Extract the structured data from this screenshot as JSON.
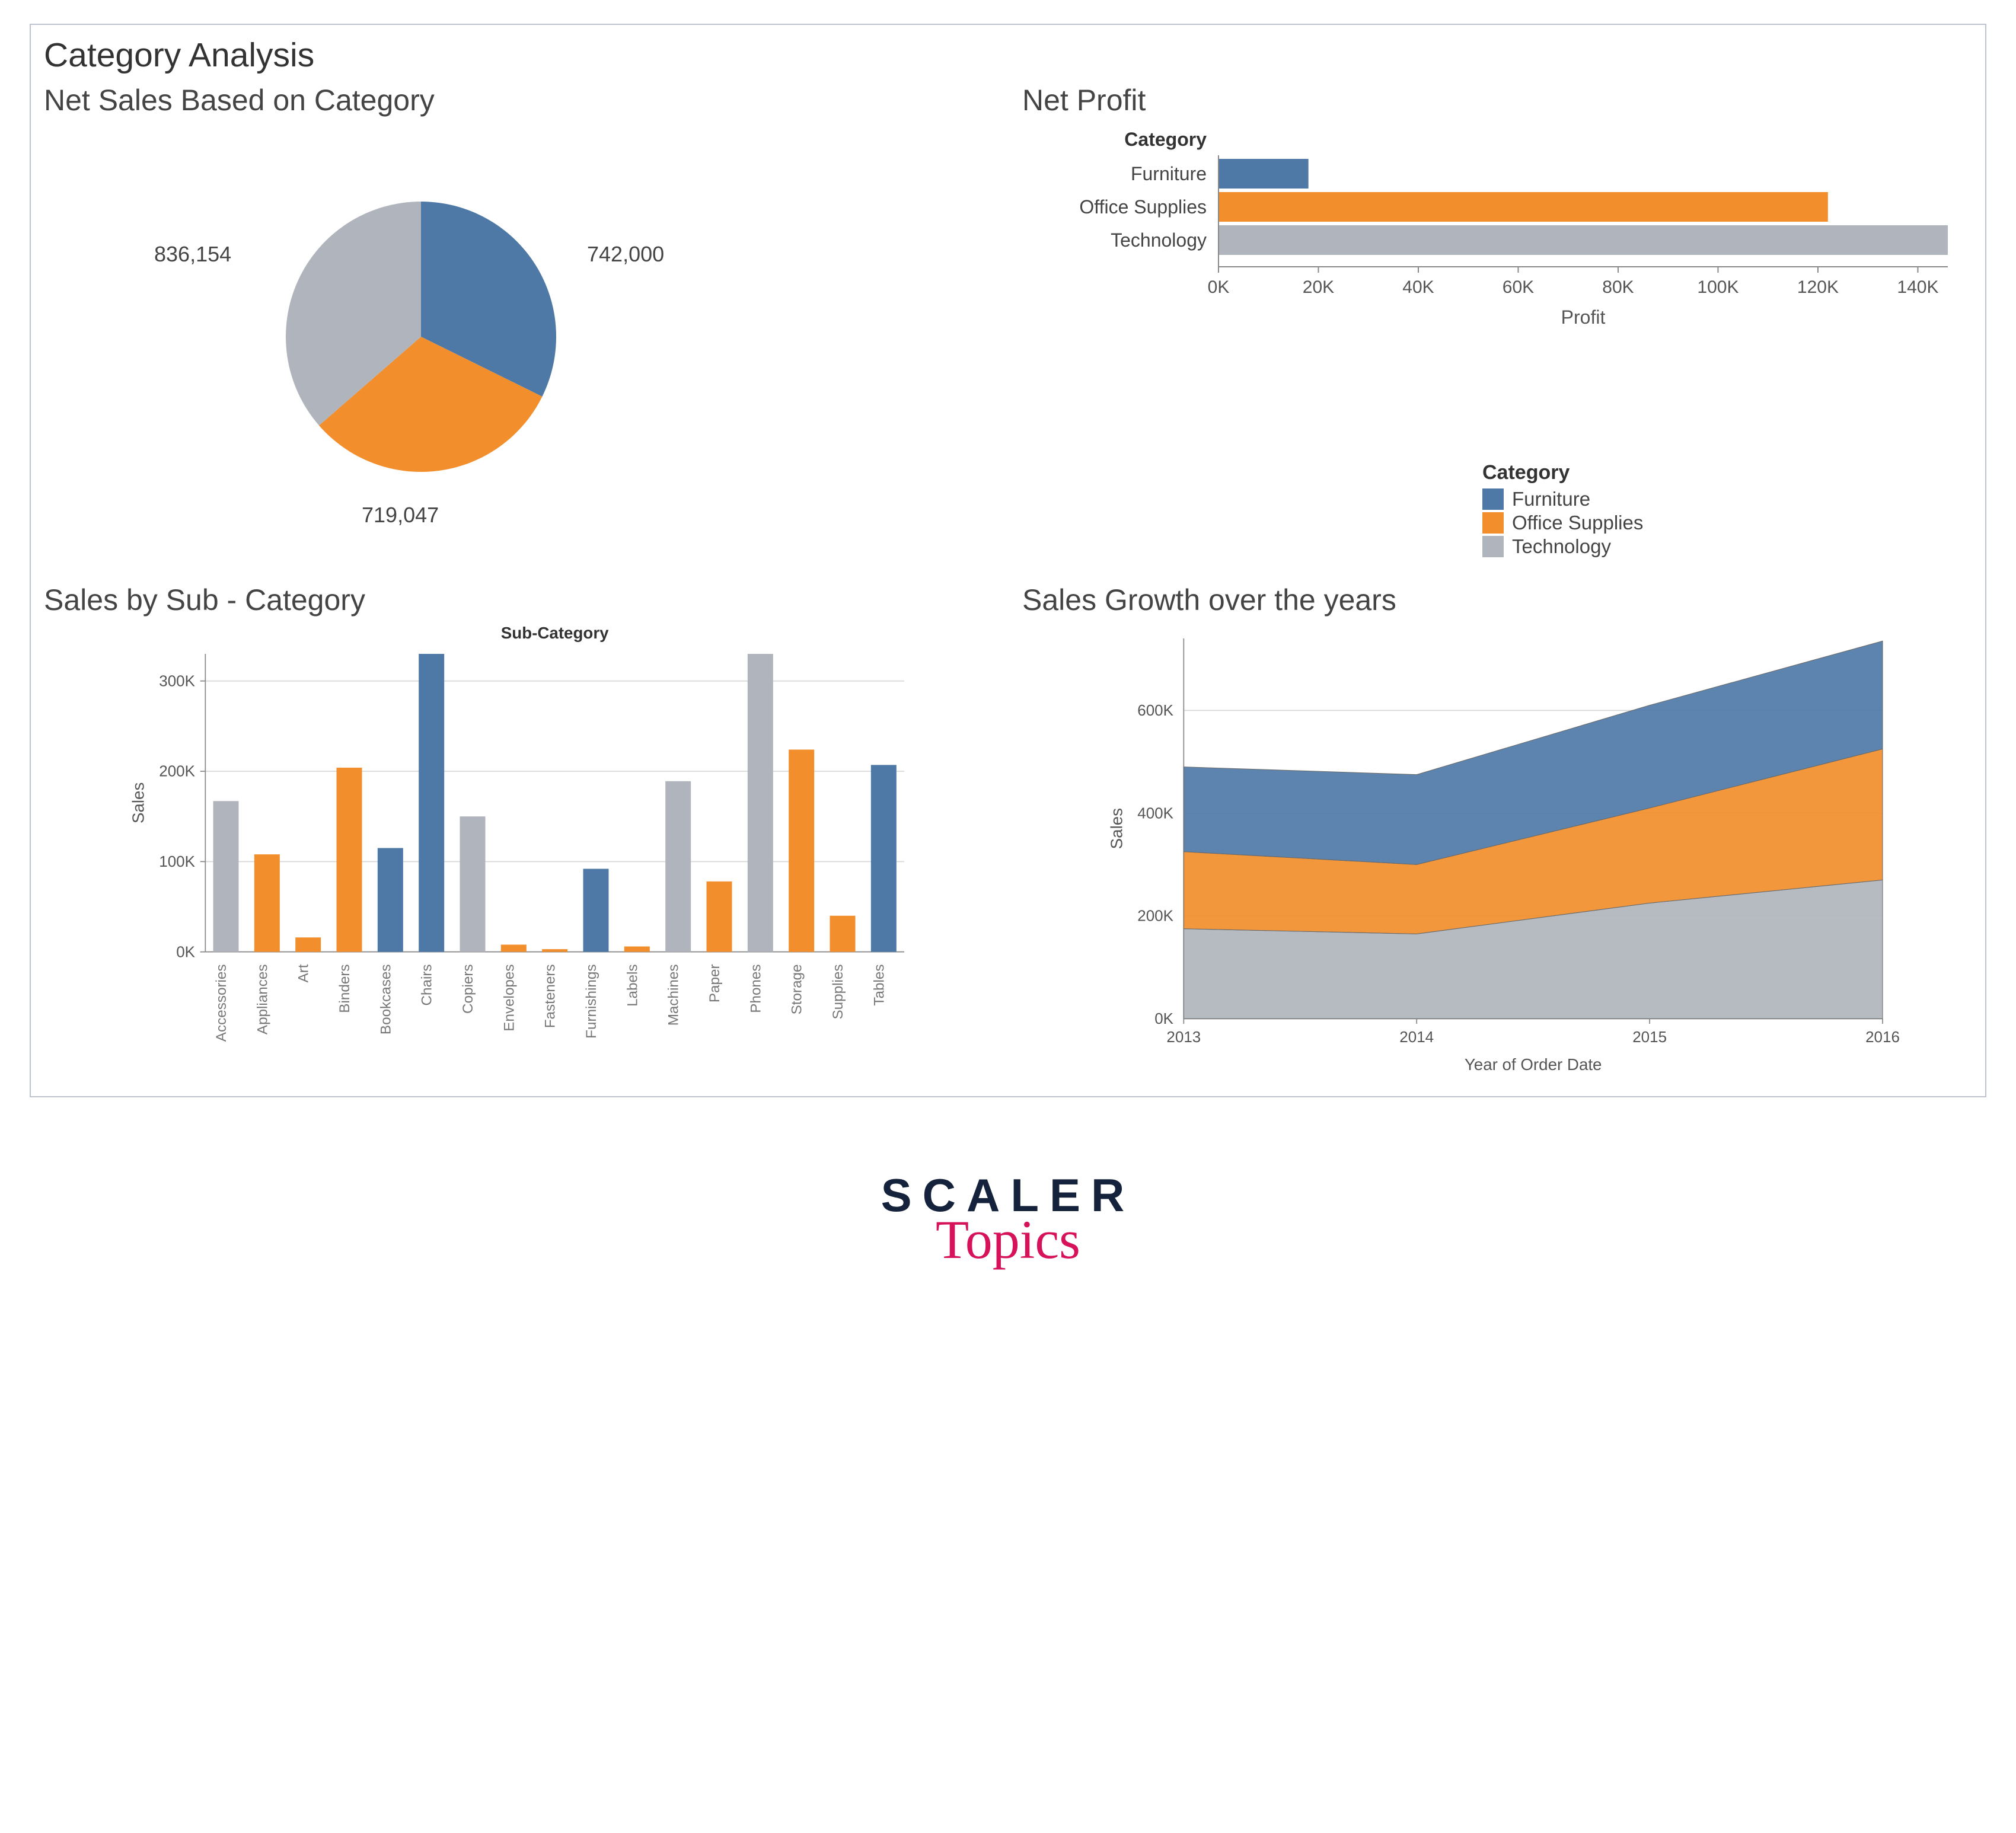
{
  "dashboard_title": "Category Analysis",
  "colors": {
    "Furniture": "#4E79A7",
    "Office Supplies": "#F28E2B",
    "Technology": "#B0B5BD"
  },
  "pie": {
    "title": "Net Sales Based on Category",
    "labels": {
      "furniture": "742,000",
      "office": "719,047",
      "technology": "836,154"
    }
  },
  "profit": {
    "title": "Net Profit",
    "header": "Category",
    "xlabel": "Profit",
    "ticks": [
      "0K",
      "20K",
      "40K",
      "60K",
      "80K",
      "100K",
      "120K",
      "140K"
    ]
  },
  "legend": {
    "title": "Category",
    "items": [
      "Furniture",
      "Office Supplies",
      "Technology"
    ]
  },
  "vbar": {
    "title": "Sales by Sub - Category",
    "header": "Sub-Category",
    "ylabel": "Sales",
    "yticks": [
      "0K",
      "100K",
      "200K",
      "300K"
    ]
  },
  "area": {
    "title": "Sales Growth over the years",
    "ylabel": "Sales",
    "xlabel": "Year of Order Date",
    "yticks": [
      "0K",
      "200K",
      "400K",
      "600K"
    ],
    "xticks": [
      "2013",
      "2014",
      "2015",
      "2016"
    ]
  },
  "branding": {
    "line1": "SCALER",
    "line2": "Topics"
  },
  "chart_data": [
    {
      "id": "net_sales_pie",
      "type": "pie",
      "title": "Net Sales Based on Category",
      "categories": [
        "Furniture",
        "Office Supplies",
        "Technology"
      ],
      "values": [
        742000,
        719047,
        836154
      ],
      "colors": [
        "#4E79A7",
        "#F28E2B",
        "#B0B5BD"
      ]
    },
    {
      "id": "net_profit_bar",
      "type": "bar",
      "orientation": "horizontal",
      "title": "Net Profit",
      "xlabel": "Profit",
      "categories": [
        "Furniture",
        "Office Supplies",
        "Technology"
      ],
      "values": [
        18000,
        122000,
        146000
      ],
      "colors": [
        "#4E79A7",
        "#F28E2B",
        "#B0B5BD"
      ],
      "xlim": [
        0,
        146000
      ],
      "xticks": [
        0,
        20000,
        40000,
        60000,
        80000,
        100000,
        120000,
        140000
      ]
    },
    {
      "id": "sales_by_subcategory",
      "type": "bar",
      "orientation": "vertical",
      "title": "Sales by Sub - Category",
      "ylabel": "Sales",
      "ylim": [
        0,
        330000
      ],
      "yticks": [
        0,
        100000,
        200000,
        300000
      ],
      "categories": [
        "Accessories",
        "Appliances",
        "Art",
        "Binders",
        "Bookcases",
        "Chairs",
        "Copiers",
        "Envelopes",
        "Fasteners",
        "Furnishings",
        "Labels",
        "Machines",
        "Paper",
        "Phones",
        "Storage",
        "Supplies",
        "Tables"
      ],
      "values": [
        167000,
        108000,
        16000,
        204000,
        115000,
        330000,
        150000,
        8000,
        3000,
        92000,
        6000,
        189000,
        78000,
        330000,
        224000,
        40000,
        207000
      ],
      "series_category": [
        "Technology",
        "Office Supplies",
        "Office Supplies",
        "Office Supplies",
        "Furniture",
        "Furniture",
        "Technology",
        "Office Supplies",
        "Office Supplies",
        "Furniture",
        "Office Supplies",
        "Technology",
        "Office Supplies",
        "Technology",
        "Office Supplies",
        "Office Supplies",
        "Furniture"
      ],
      "series_colors": {
        "Furniture": "#4E79A7",
        "Office Supplies": "#F28E2B",
        "Technology": "#B0B5BD"
      }
    },
    {
      "id": "sales_growth_area",
      "type": "area",
      "stacked": true,
      "title": "Sales Growth over the years",
      "xlabel": "Year of Order Date",
      "ylabel": "Sales",
      "x": [
        2013,
        2014,
        2015,
        2016
      ],
      "series": [
        {
          "name": "Technology",
          "color": "#B0B5BD",
          "values": [
            175000,
            165000,
            225000,
            270000
          ]
        },
        {
          "name": "Office Supplies",
          "color": "#F28E2B",
          "values": [
            150000,
            135000,
            185000,
            255000
          ]
        },
        {
          "name": "Furniture",
          "color": "#4E79A7",
          "values": [
            165000,
            175000,
            200000,
            210000
          ]
        }
      ],
      "ylim": [
        0,
        740000
      ],
      "yticks": [
        0,
        200000,
        400000,
        600000
      ]
    }
  ]
}
